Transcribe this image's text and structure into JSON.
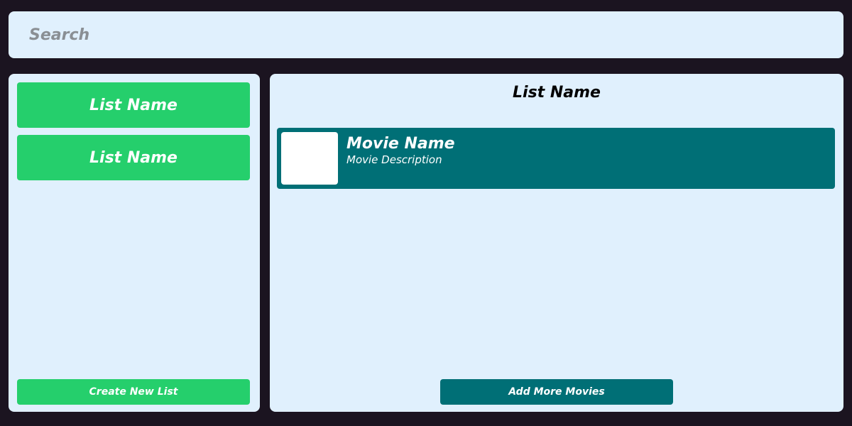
{
  "search": {
    "placeholder": "Search",
    "value": ""
  },
  "sidebar": {
    "lists": [
      {
        "label": "List Name"
      },
      {
        "label": "List Name"
      }
    ],
    "create_label": "Create New List"
  },
  "main": {
    "title": "List Name",
    "movies": [
      {
        "name": "Movie Name",
        "description": "Movie Description"
      }
    ],
    "add_label": "Add More Movies"
  },
  "colors": {
    "background": "#1b1420",
    "panel": "#e0f0fd",
    "list_button": "#25cf6c",
    "movie_card": "#006f76",
    "thumbnail": "#ffffff"
  }
}
